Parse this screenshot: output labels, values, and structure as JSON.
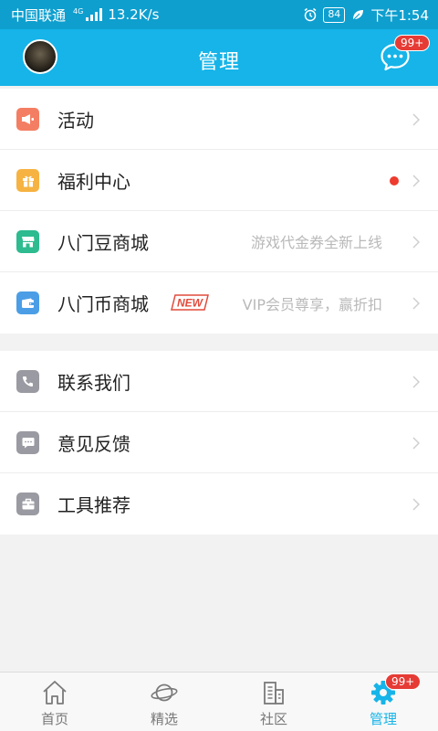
{
  "status_bar": {
    "carrier": "中国联通",
    "network": "4G",
    "speed": "13.2K/s",
    "battery": "84",
    "time": "下午1:54"
  },
  "header": {
    "title": "管理",
    "message_badge": "99+"
  },
  "menu_groups": [
    {
      "items": [
        {
          "label": "活动",
          "icon": "megaphone-icon",
          "icon_color": "#f47e63"
        },
        {
          "label": "福利中心",
          "icon": "gift-icon",
          "icon_color": "#f6b342",
          "dot": true
        },
        {
          "label": "八门豆商城",
          "icon": "store-icon",
          "icon_color": "#2dbb8f",
          "hint": "游戏代金券全新上线"
        },
        {
          "label": "八门币商城",
          "icon": "wallet-icon",
          "icon_color": "#4b9ee6",
          "badge": "NEW",
          "hint": "VIP会员尊享，赢折扣"
        }
      ]
    },
    {
      "items": [
        {
          "label": "联系我们",
          "icon": "phone-icon",
          "icon_color": "#9a9aa2"
        },
        {
          "label": "意见反馈",
          "icon": "comment-icon",
          "icon_color": "#9a9aa2"
        },
        {
          "label": "工具推荐",
          "icon": "toolbox-icon",
          "icon_color": "#9a9aa2"
        }
      ]
    }
  ],
  "tabs": [
    {
      "label": "首页",
      "icon": "home-icon",
      "active": false
    },
    {
      "label": "精选",
      "icon": "planet-icon",
      "active": false
    },
    {
      "label": "社区",
      "icon": "building-icon",
      "active": false
    },
    {
      "label": "管理",
      "icon": "gear-icon",
      "active": true,
      "badge": "99+"
    }
  ],
  "colors": {
    "status_bar": "#0e9fcf",
    "header": "#16b4e8",
    "accent": "#16b4e8",
    "badge": "#e63b35"
  }
}
